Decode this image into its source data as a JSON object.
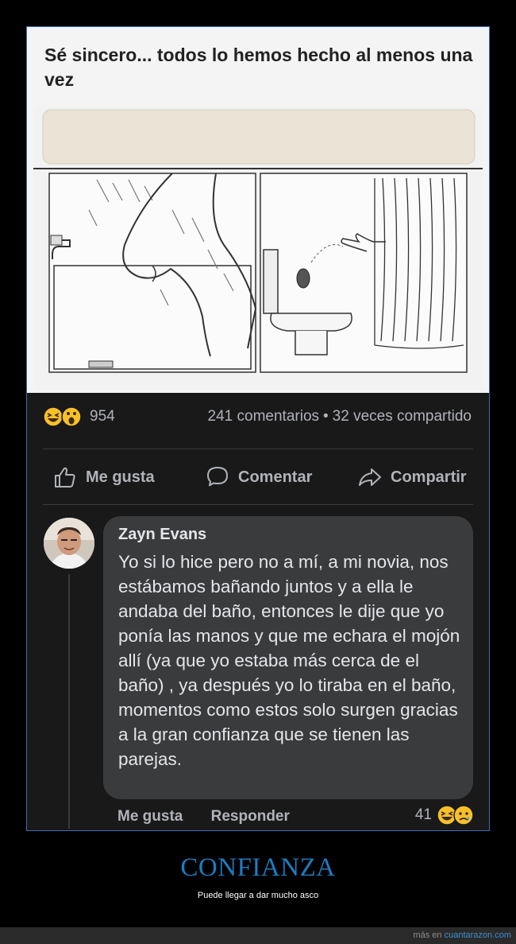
{
  "post": {
    "title": "Sé sincero... todos lo hemos hecho al menos una vez",
    "reactions": {
      "count": "954",
      "icons": [
        "haha-emoji-icon",
        "wow-emoji-icon"
      ]
    },
    "comments_count": "241 comentarios",
    "separator": "•",
    "shares": "32 veces compartido",
    "actions": {
      "like": "Me gusta",
      "comment": "Comentar",
      "share": "Compartir"
    }
  },
  "comment": {
    "author": "Zayn Evans",
    "text": "Yo si lo hice pero no a mí, a mi novia, nos estábamos bañando juntos y a ella le andaba del baño, entonces le dije que yo ponía las manos y que me echara el mojón allí (ya que yo estaba más cerca de el baño) , ya después yo lo tiraba en el baño, momentos como estos solo surgen gracias a la gran confianza que se tienen las parejas.",
    "like_label": "Me gusta",
    "reply_label": "Responder",
    "reaction_count": "41",
    "reaction_icons": [
      "haha-emoji-icon",
      "sad-emoji-icon"
    ]
  },
  "caption": {
    "title": "CONFIANZA",
    "subtitle": "Puede llegar a dar mucho asco"
  },
  "footer": {
    "prefix": "más en",
    "site": "cuantarazon.com"
  },
  "colors": {
    "accent": "#1f7bc0",
    "frame_border": "#3b6db4",
    "bubble": "#3a3b3c",
    "text_muted": "#b0b3b8"
  }
}
